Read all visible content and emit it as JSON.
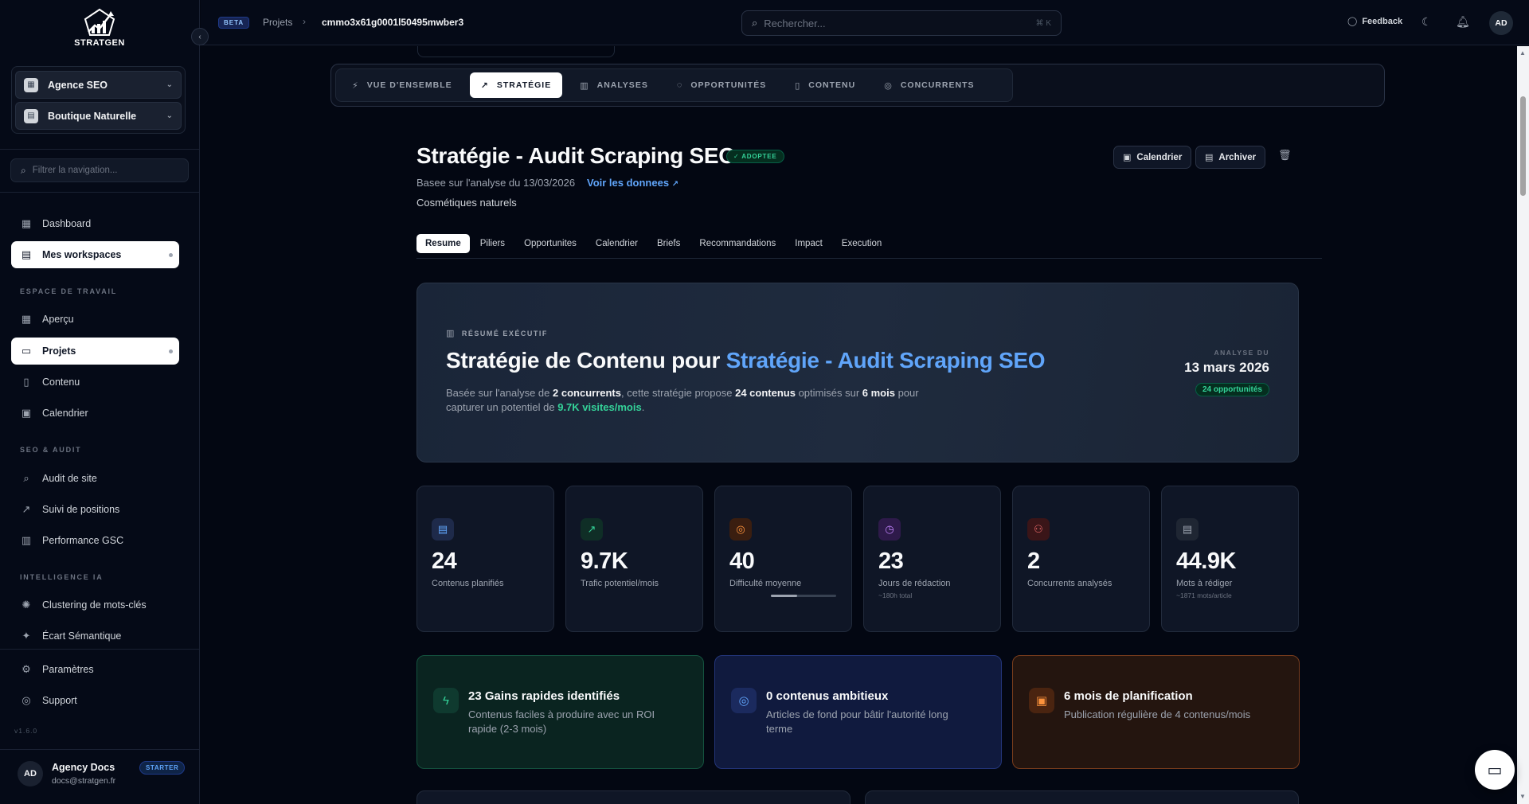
{
  "brand": {
    "name": "STRATGEN"
  },
  "sidebar": {
    "workspaces": [
      {
        "label": "Agence SEO"
      },
      {
        "label": "Boutique Naturelle"
      }
    ],
    "filter_placeholder": "Filtrer la navigation...",
    "top_items": [
      {
        "label": "Dashboard",
        "icon": "grid-icon"
      },
      {
        "label": "Mes workspaces",
        "icon": "building-icon",
        "active": true
      }
    ],
    "sections": [
      {
        "title": "ESPACE DE TRAVAIL",
        "items": [
          {
            "label": "Aperçu",
            "icon": "grid-icon"
          },
          {
            "label": "Projets",
            "icon": "folder-icon",
            "active": true
          },
          {
            "label": "Contenu",
            "icon": "file-icon"
          },
          {
            "label": "Calendrier",
            "icon": "calendar-icon"
          }
        ]
      },
      {
        "title": "SEO & AUDIT",
        "items": [
          {
            "label": "Audit de site",
            "icon": "search-icon"
          },
          {
            "label": "Suivi de positions",
            "icon": "trend-icon"
          },
          {
            "label": "Performance GSC",
            "icon": "bar-chart-icon"
          }
        ]
      },
      {
        "title": "INTELLIGENCE IA",
        "items": [
          {
            "label": "Clustering de mots-clés",
            "icon": "brain-icon"
          },
          {
            "label": "Écart Sémantique",
            "icon": "sparkles-icon"
          }
        ]
      }
    ],
    "bottom_items": [
      {
        "label": "Paramètres",
        "icon": "gear-icon"
      },
      {
        "label": "Support",
        "icon": "lifebuoy-icon"
      }
    ],
    "version": "v1.6.0",
    "user": {
      "initials": "AD",
      "name": "Agency Docs",
      "email": "docs@stratgen.fr",
      "plan": "STARTER"
    }
  },
  "topbar": {
    "beta": "BETA",
    "breadcrumb": [
      "Projets",
      "cmmo3x61g0001l50495mwber3"
    ],
    "search_placeholder": "Rechercher...",
    "search_shortcut": "⌘ K",
    "feedback": "Feedback",
    "avatar": "AD"
  },
  "tabs": [
    {
      "label": "VUE D'ENSEMBLE",
      "icon": "bolt-icon"
    },
    {
      "label": "STRATÉGIE",
      "icon": "trend-icon",
      "active": true
    },
    {
      "label": "ANALYSES",
      "icon": "bar-chart-icon"
    },
    {
      "label": "OPPORTUNITÉS",
      "icon": "lightbulb-icon"
    },
    {
      "label": "CONTENU",
      "icon": "file-icon"
    },
    {
      "label": "CONCURRENTS",
      "icon": "target-icon"
    }
  ],
  "header": {
    "title": "Stratégie - Audit Scraping SEO",
    "status": "ADOPTEE",
    "based_on": "Basee sur l'analyse du 13/03/2026",
    "view_data": "Voir les donnees",
    "subtitle": "Cosmétiques naturels",
    "buttons": {
      "calendar": "Calendrier",
      "archive": "Archiver"
    }
  },
  "subtabs": [
    "Resume",
    "Piliers",
    "Opportunites",
    "Calendrier",
    "Briefs",
    "Recommandations",
    "Impact",
    "Execution"
  ],
  "hero": {
    "label": "RÉSUMÉ EXÉCUTIF",
    "title_prefix": "Stratégie de Contenu pour ",
    "title_highlight": "Stratégie - Audit Scraping SEO",
    "desc": {
      "t1": "Basée sur l'analyse de ",
      "b1": "2 concurrents",
      "t2": ", cette stratégie propose ",
      "b2": "24 contenus",
      "t3": " optimisés sur ",
      "b3": "6 mois",
      "t4": " pour capturer un potentiel de ",
      "g1": "9.7K visites/mois",
      "t5": "."
    },
    "analysis_label": "ANALYSE DU",
    "analysis_date": "13 mars 2026",
    "opportunities": "24 opportunités"
  },
  "kpis": [
    {
      "value": "24",
      "label": "Contenus planifiés",
      "sub": "",
      "icon": "document-icon",
      "color": "#60a5fa",
      "bg": "#1e2a4a"
    },
    {
      "value": "9.7K",
      "label": "Trafic potentiel/mois",
      "sub": "",
      "icon": "trend-up-icon",
      "color": "#34d399",
      "bg": "#0f2e26"
    },
    {
      "value": "40",
      "label": "Difficulté moyenne",
      "sub": "",
      "icon": "target-icon",
      "color": "#fb923c",
      "bg": "#3a1e10",
      "progress": 0.4
    },
    {
      "value": "23",
      "label": "Jours de rédaction",
      "sub": "~180h total",
      "icon": "clock-icon",
      "color": "#c084fc",
      "bg": "#2e1a4a"
    },
    {
      "value": "2",
      "label": "Concurrents analysés",
      "sub": "",
      "icon": "users-icon",
      "color": "#f87171",
      "bg": "#3a1518"
    },
    {
      "value": "44.9K",
      "label": "Mots à rédiger",
      "sub": "~1871 mots/article",
      "icon": "document-icon",
      "color": "#9ca3af",
      "bg": "#1f2633"
    }
  ],
  "cards": [
    {
      "title": "23 Gains rapides identifiés",
      "desc": "Contenus faciles à produire avec un ROI rapide (2-3 mois)",
      "icon": "bolt-icon",
      "color": "#34d399",
      "bg": "#0a2420",
      "border": "#14533f",
      "ibg": "#0f3a2f"
    },
    {
      "title": "0 contenus ambitieux",
      "desc": "Articles de fond pour bâtir l'autorité long terme",
      "icon": "target-icon",
      "color": "#60a5fa",
      "bg": "#101a3e",
      "border": "#23357a",
      "ibg": "#1b2a5e"
    },
    {
      "title": "6 mois de planification",
      "desc": "Publication régulière de 4 contenus/mois",
      "icon": "calendar-icon",
      "color": "#fb923c",
      "bg": "#24150f",
      "border": "#7a3d1c",
      "ibg": "#4a2410"
    }
  ]
}
